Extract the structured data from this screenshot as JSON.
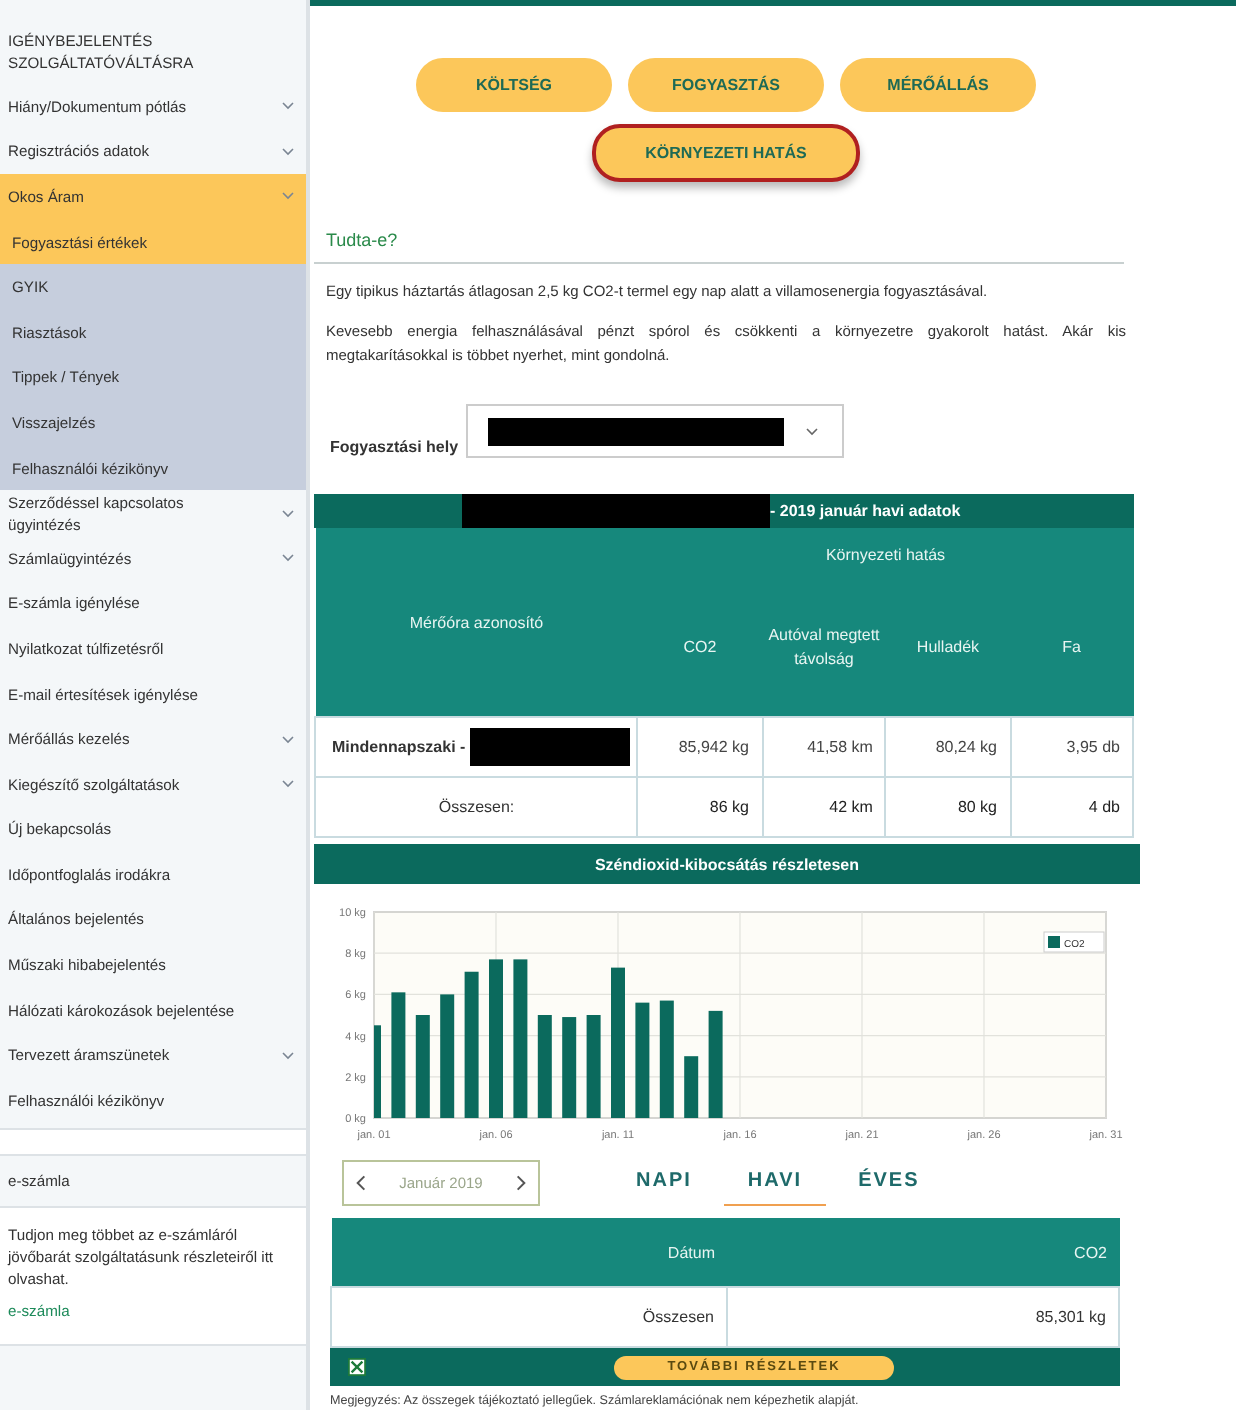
{
  "sidebar": {
    "items": [
      {
        "label": "IGÉNYBEJELENTÉS SZOLGÁLTATÓVÁLTÁSRA",
        "kind": "link"
      },
      {
        "label": "Hiány/Dokumentum pótlás",
        "kind": "group",
        "expanded": false
      },
      {
        "label": "Regisztrációs adatok",
        "kind": "group",
        "expanded": false
      },
      {
        "label": "Okos Áram",
        "kind": "group",
        "expanded": true,
        "children": [
          {
            "label": "Fogyasztási értékek",
            "selected": true
          },
          {
            "label": "GYIK",
            "selected": false
          },
          {
            "label": "Riasztások",
            "selected": false
          },
          {
            "label": "Tippek / Tények",
            "selected": false
          },
          {
            "label": "Visszajelzés",
            "selected": false
          },
          {
            "label": "Felhasználói kézikönyv",
            "selected": false
          }
        ]
      },
      {
        "label": "Szerződéssel kapcsolatos ügyintézés",
        "kind": "group",
        "expanded": false
      },
      {
        "label": "Számlaügyintézés",
        "kind": "group",
        "expanded": false
      },
      {
        "label": "E-számla igénylése",
        "kind": "link"
      },
      {
        "label": "Nyilatkozat túlfizetésről",
        "kind": "link"
      },
      {
        "label": "E-mail értesítések igénylése",
        "kind": "link"
      },
      {
        "label": "Mérőállás kezelés",
        "kind": "group",
        "expanded": false
      },
      {
        "label": "Kiegészítő szolgáltatások",
        "kind": "group",
        "expanded": false
      },
      {
        "label": "Új bekapcsolás",
        "kind": "link"
      },
      {
        "label": "Időpontfoglalás irodákra",
        "kind": "link"
      },
      {
        "label": "Általános bejelentés",
        "kind": "link"
      },
      {
        "label": "Műszaki hibabejelentés",
        "kind": "link"
      },
      {
        "label": "Hálózati károkozások bejelentése",
        "kind": "link"
      },
      {
        "label": "Tervezett áramszünetek",
        "kind": "group",
        "expanded": false
      },
      {
        "label": "Felhasználói kézikönyv",
        "kind": "link"
      }
    ],
    "info_box": {
      "title": "e-számla",
      "text": "Tudjon meg többet az e-számláról jövőbarát szolgáltatásunk részleteiről itt olvashat.",
      "link": "e-számla"
    }
  },
  "tabs": [
    {
      "label": "KÖLTSÉG",
      "selected": false
    },
    {
      "label": "FOGYASZTÁS",
      "selected": false
    },
    {
      "label": "MÉRŐÁLLÁS",
      "selected": false
    },
    {
      "label": "KÖRNYEZETI HATÁS",
      "selected": true
    }
  ],
  "tip": {
    "title": "Tudta-e?",
    "paragraphs": [
      "Egy tipikus háztartás átlagosan 2,5 kg CO2-t termel egy nap alatt a villamosenergia fogyasztásával.",
      "Kevesebb energia felhasználásával pénzt spórol és csökkenti a környezetre gyakorolt hatást. Akár kis megtakarításokkal is többet nyerhet, mint gondolná."
    ]
  },
  "location": {
    "label": "Fogyasztási hely"
  },
  "summary_table": {
    "title": "- 2019 január havi adatok",
    "group_header": "Környezeti hatás",
    "columns": [
      "Mérőóra azonosító",
      "CO2",
      "Autóval megtett távolság",
      "Hulladék",
      "Fa"
    ],
    "rows": [
      {
        "kind": "meter",
        "cells": [
          "Mindennapszaki -",
          "85,942 kg",
          "41,58 km",
          "80,24 kg",
          "3,95 db"
        ]
      },
      {
        "kind": "total",
        "cells": [
          "Összesen:",
          "86 kg",
          "42 km",
          "80 kg",
          "4 db"
        ]
      }
    ]
  },
  "chart_section": {
    "title": "Széndioxid-kibocsátás részletesen",
    "chart_data": {
      "type": "bar",
      "categories": [
        "jan. 01",
        null,
        null,
        null,
        null,
        "jan. 06",
        null,
        null,
        null,
        null,
        "jan. 11",
        null,
        null,
        null,
        null,
        "jan. 16",
        null,
        null,
        null,
        null,
        "jan. 21",
        null,
        null,
        null,
        null,
        "jan. 26",
        null,
        null,
        null,
        null,
        "jan. 31"
      ],
      "grid": true,
      "series": [
        {
          "name": "CO2",
          "color": "#0b6a5d",
          "values": [
            4.5,
            6.1,
            5.0,
            6.0,
            7.1,
            7.7,
            7.7,
            5.0,
            4.9,
            5.0,
            7.3,
            5.6,
            5.7,
            3.0,
            5.2,
            null,
            null,
            null,
            null,
            null,
            null,
            null,
            null,
            null,
            null,
            null,
            null,
            null,
            null,
            null,
            null
          ]
        }
      ],
      "ylim": [
        0,
        10
      ],
      "yticks": [
        {
          "value": 0,
          "label": "0 kg"
        },
        {
          "value": 2,
          "label": "2 kg"
        },
        {
          "value": 4,
          "label": "4 kg"
        },
        {
          "value": 6,
          "label": "6 kg"
        },
        {
          "value": 8,
          "label": "8 kg"
        },
        {
          "value": 10,
          "label": "10 kg"
        }
      ]
    }
  },
  "period": {
    "label": "Január 2019"
  },
  "views": [
    {
      "label": "NAPI",
      "selected": false
    },
    {
      "label": "HAVI",
      "selected": true
    },
    {
      "label": "ÉVES",
      "selected": false
    }
  ],
  "detail_table": {
    "columns": [
      "Dátum",
      "CO2"
    ],
    "rows": [
      [
        "Összesen",
        "85,301 kg"
      ]
    ],
    "more_button": "TOVÁBBI RÉSZLETEK"
  },
  "note": "Megjegyzés: Az összegek tájékoztató jellegűek. Számlareklamációnak nem képezhetik alapját."
}
